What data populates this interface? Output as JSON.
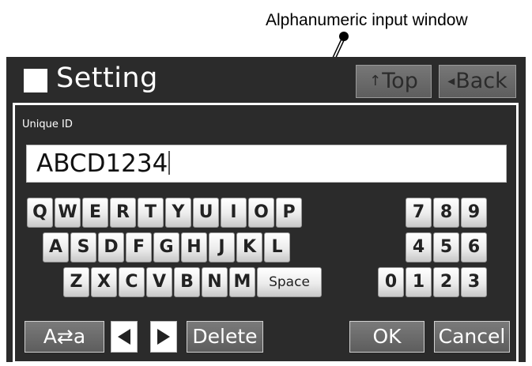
{
  "callout": {
    "label": "Alphanumeric input window"
  },
  "header": {
    "title": "Setting",
    "top_icon": "↑",
    "top_label": "Top",
    "back_icon": "◂",
    "back_label": "Back"
  },
  "input": {
    "label": "Unique ID",
    "value": "ABCD1234"
  },
  "keyboard": {
    "letters": {
      "row1": [
        "Q",
        "W",
        "E",
        "R",
        "T",
        "Y",
        "U",
        "I",
        "O",
        "P"
      ],
      "row2": [
        "A",
        "S",
        "D",
        "F",
        "G",
        "H",
        "J",
        "K",
        "L"
      ],
      "row3": [
        "Z",
        "X",
        "C",
        "V",
        "B",
        "N",
        "M"
      ]
    },
    "space_label": "Space",
    "digits": {
      "row1": [
        "7",
        "8",
        "9"
      ],
      "row2": [
        "4",
        "5",
        "6"
      ],
      "row3": [
        "0",
        "1",
        "2",
        "3"
      ]
    }
  },
  "footer": {
    "case_toggle_label": "A⇄a",
    "delete_label": "Delete",
    "ok_label": "OK",
    "cancel_label": "Cancel"
  }
}
